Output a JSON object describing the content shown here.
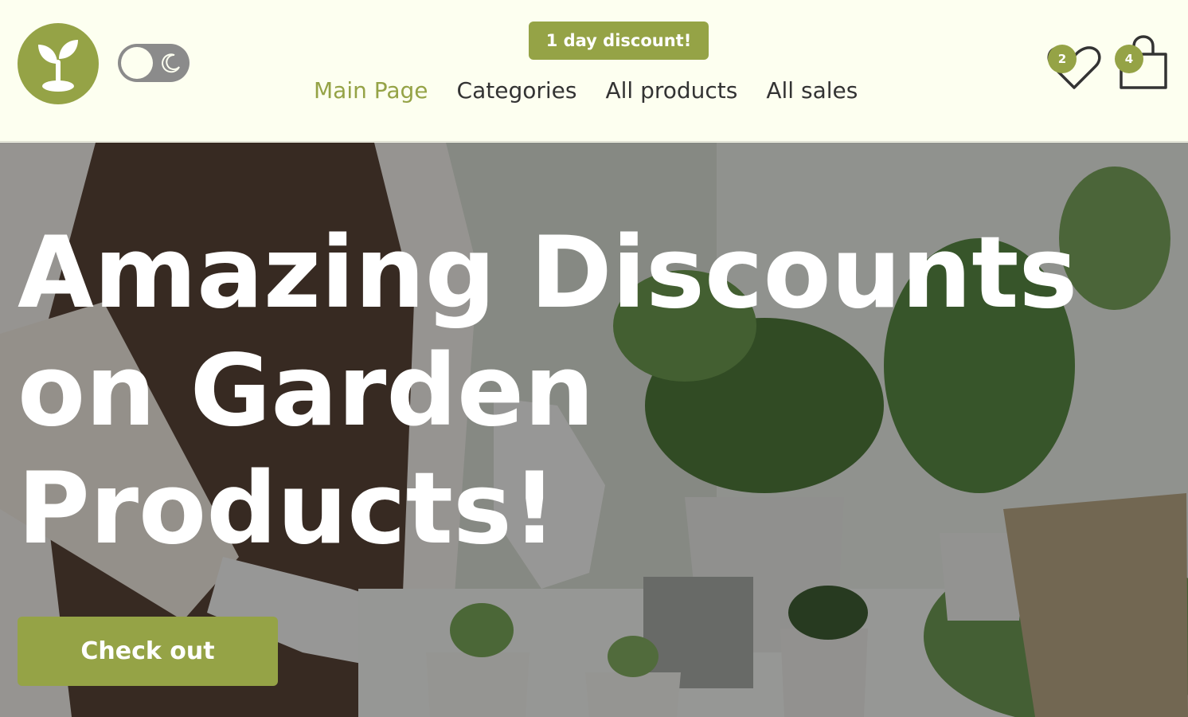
{
  "header": {
    "discount_badge": "1 day discount!",
    "nav": [
      {
        "label": "Main Page",
        "active": true
      },
      {
        "label": "Categories",
        "active": false
      },
      {
        "label": "All products",
        "active": false
      },
      {
        "label": "All sales",
        "active": false
      }
    ],
    "favorites_count": "2",
    "cart_count": "4",
    "icons": {
      "logo": "sprout-icon",
      "theme": "moon-icon",
      "favorites": "heart-icon",
      "cart": "shopping-bag-icon"
    }
  },
  "hero": {
    "title": "Amazing Discounts on Garden Products!",
    "cta_label": "Check out"
  },
  "colors": {
    "accent": "#95a346",
    "header_bg": "#fdfff0",
    "text": "#333333",
    "toggle": "#8b8b8b"
  }
}
